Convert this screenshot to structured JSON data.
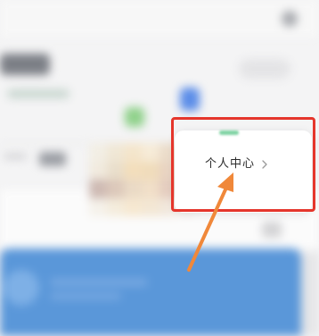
{
  "popup_menu": {
    "item_label": "个人中心",
    "chevron_icon": "chevron-right-icon"
  },
  "annotations": {
    "highlight_color": "#e5362c",
    "arrow_color": "#f0883a"
  },
  "colors": {
    "banner_blue": "#5a97d9",
    "tile_blue": "#5b8de8",
    "tile_green": "#8fd18a"
  }
}
